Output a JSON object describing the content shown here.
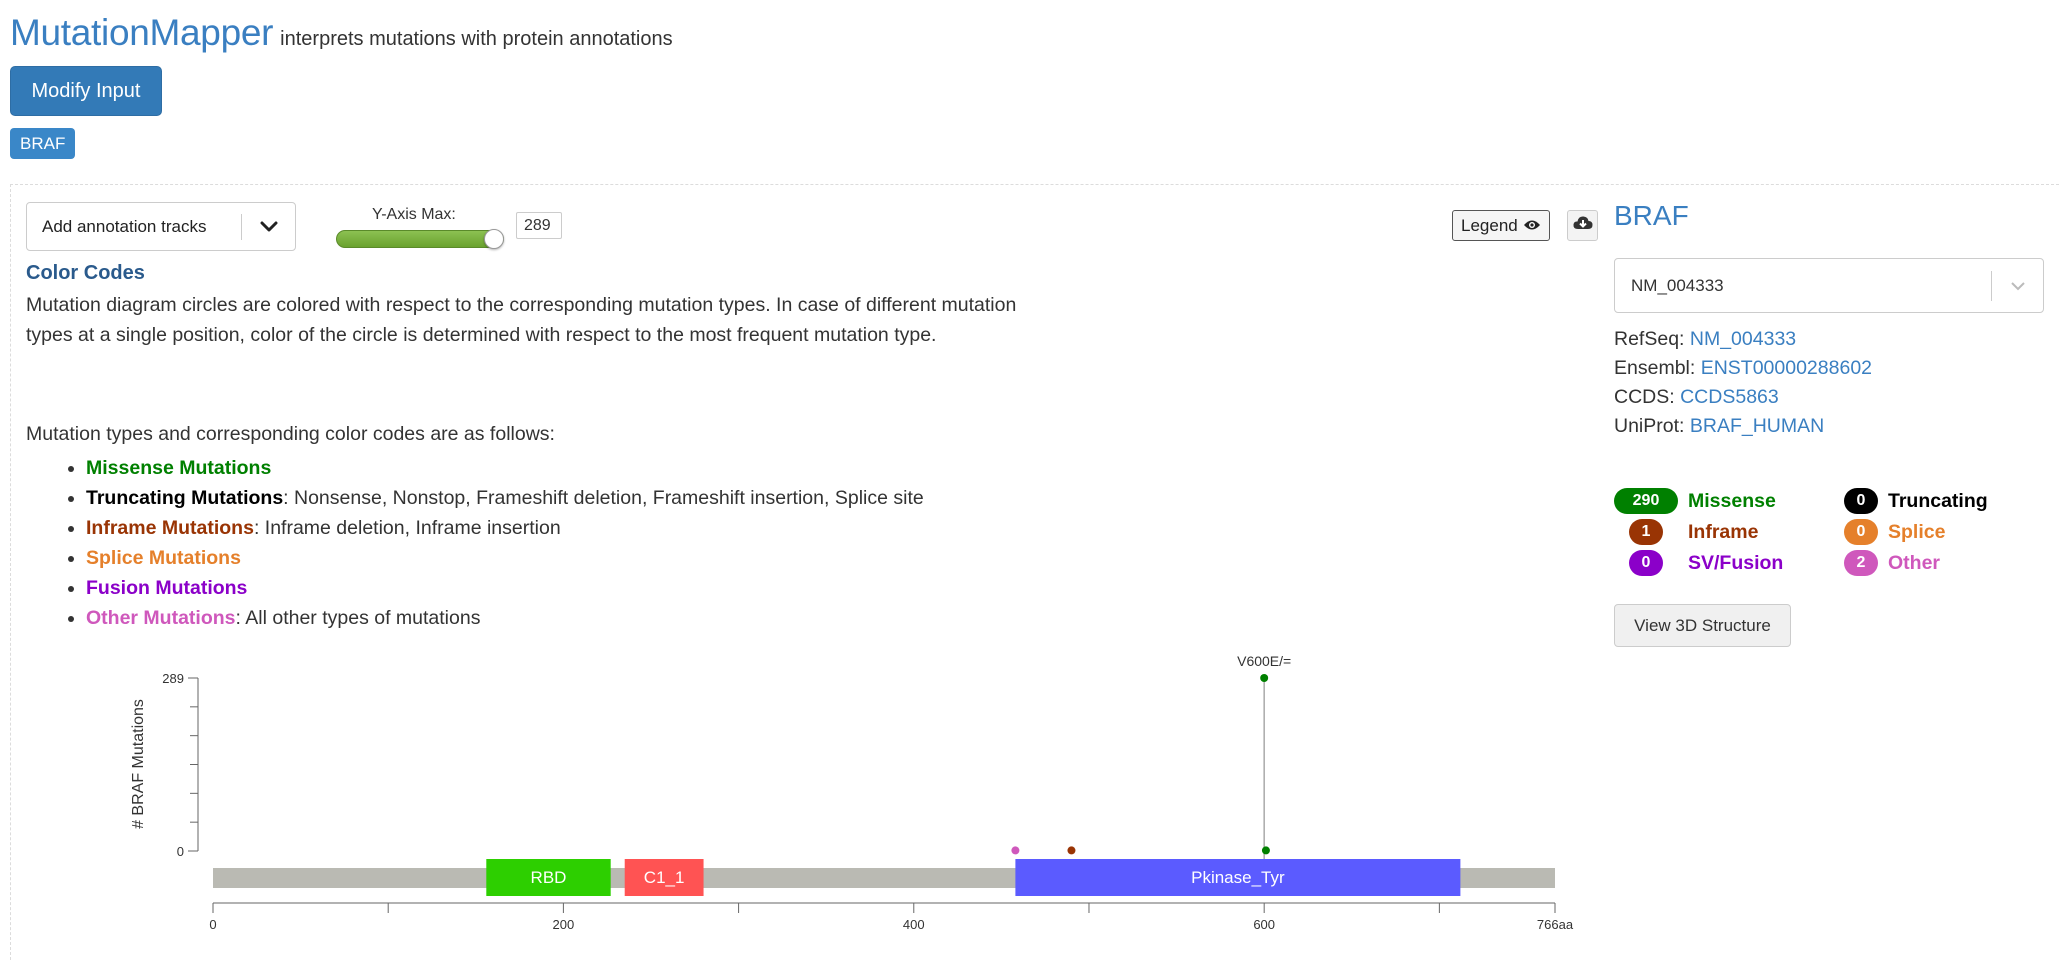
{
  "header": {
    "title": "MutationMapper",
    "subtitle": "interprets mutations with protein annotations"
  },
  "modify_button": "Modify Input",
  "gene_tag": "BRAF",
  "toolbar": {
    "annotation_dropdown": "Add annotation tracks",
    "y_axis_label": "Y-Axis Max:",
    "y_axis_max": "289",
    "legend_button": "Legend"
  },
  "color_codes": {
    "title": "Color Codes",
    "paragraph": "Mutation diagram circles are colored with respect to the corresponding mutation types. In case of different mutation types at a single position, color of the circle is determined with respect to the most frequent mutation type.",
    "intro": "Mutation types and corresponding color codes are as follows:",
    "items": [
      {
        "name": "Missense Mutations",
        "desc": "",
        "color": "#008000"
      },
      {
        "name": "Truncating Mutations",
        "desc": ": Nonsense, Nonstop, Frameshift deletion, Frameshift insertion, Splice site",
        "color": "#000000"
      },
      {
        "name": "Inframe Mutations",
        "desc": ": Inframe deletion, Inframe insertion",
        "color": "#993404"
      },
      {
        "name": "Splice Mutations",
        "desc": "",
        "color": "#e5802b"
      },
      {
        "name": "Fusion Mutations",
        "desc": "",
        "color": "#8b00c9"
      },
      {
        "name": "Other Mutations",
        "desc": ": All other types of mutations",
        "color": "#cf58bc"
      }
    ]
  },
  "sidebar": {
    "gene": "BRAF",
    "transcript": "NM_004333",
    "refs": [
      {
        "label": "RefSeq:",
        "value": "NM_004333"
      },
      {
        "label": "Ensembl:",
        "value": "ENST00000288602"
      },
      {
        "label": "CCDS:",
        "value": "CCDS5863"
      },
      {
        "label": "UniProt:",
        "value": "BRAF_HUMAN"
      }
    ],
    "counts": [
      {
        "count": "290",
        "label": "Missense",
        "color": "#008000",
        "text_color": "#008000"
      },
      {
        "count": "0",
        "label": "Truncating",
        "color": "#000000",
        "text_color": "#000000"
      },
      {
        "count": "1",
        "label": "Inframe",
        "color": "#993404",
        "text_color": "#993404"
      },
      {
        "count": "0",
        "label": "Splice",
        "color": "#e5802b",
        "text_color": "#e5802b"
      },
      {
        "count": "0",
        "label": "SV/Fusion",
        "color": "#8b00c9",
        "text_color": "#8b00c9"
      },
      {
        "count": "2",
        "label": "Other",
        "color": "#cf58bc",
        "text_color": "#cf58bc"
      }
    ],
    "view3d_button": "View 3D Structure"
  },
  "chart_data": {
    "type": "lollipop",
    "ylabel": "# BRAF Mutations",
    "ylim": [
      0,
      289
    ],
    "y_ticks": [
      "289",
      "0"
    ],
    "protein_length": 766,
    "x_ticks": [
      {
        "value": 0,
        "label": "0"
      },
      {
        "value": 200,
        "label": "200"
      },
      {
        "value": 400,
        "label": "400"
      },
      {
        "value": 600,
        "label": "600"
      },
      {
        "value": 766,
        "label": "766aa"
      }
    ],
    "domains": [
      {
        "name": "RBD",
        "start": 156,
        "end": 227,
        "color": "#2dcf00"
      },
      {
        "name": "C1_1",
        "start": 235,
        "end": 280,
        "color": "#ff5353"
      },
      {
        "name": "Pkinase_Tyr",
        "start": 458,
        "end": 712,
        "color": "#5b5bff"
      }
    ],
    "lollipops": [
      {
        "position": 458,
        "count": 1,
        "color": "#cf58bc",
        "label": ""
      },
      {
        "position": 490,
        "count": 1,
        "color": "#993404",
        "label": ""
      },
      {
        "position": 600,
        "count": 289,
        "color": "#008000",
        "label": "V600E/="
      },
      {
        "position": 601,
        "count": 1,
        "color": "#008000",
        "label": ""
      }
    ]
  },
  "colors": {
    "accent": "#337ab7",
    "title": "#3a7fc1",
    "backbone": "#babab3"
  }
}
